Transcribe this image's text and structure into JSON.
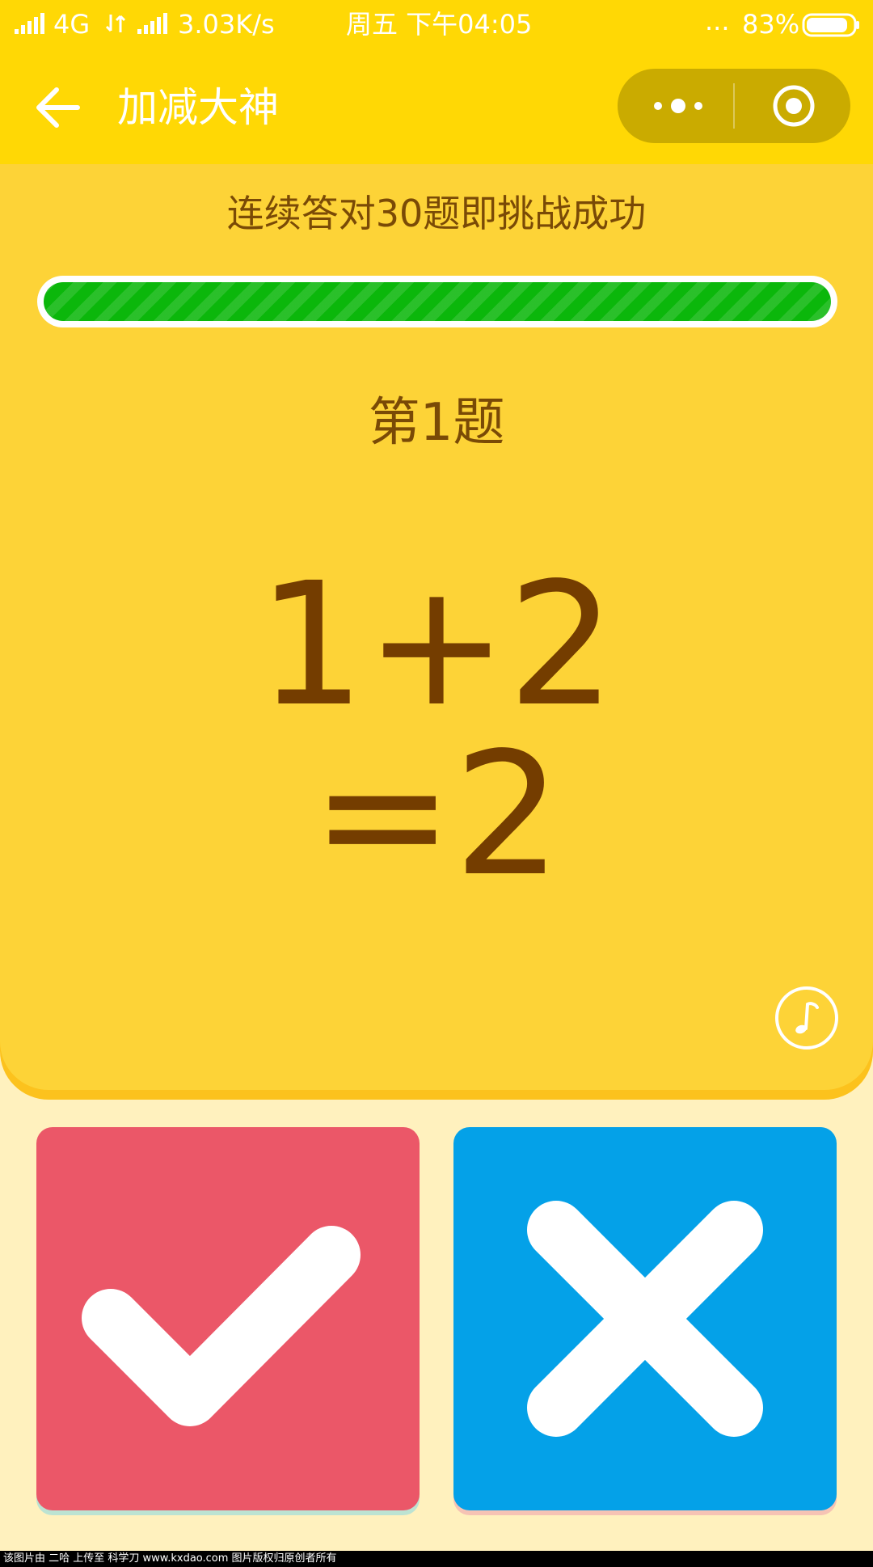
{
  "status_bar": {
    "network": "4G",
    "speed": "3.03K/s",
    "datetime": "周五 下午04:05",
    "more": "...",
    "battery": "83%"
  },
  "nav": {
    "title": "加减大神"
  },
  "game": {
    "challenge_text": "连续答对30题即挑战成功",
    "progress": 1.0,
    "question_label": "第1题",
    "expression": "1+2",
    "answer": "=2"
  },
  "buttons": {
    "correct_icon": "check-icon",
    "wrong_icon": "cross-icon"
  },
  "colors": {
    "header": "#FFD805",
    "card": "#FDD337",
    "text_brown": "#743D00",
    "progress_green": "#0BB70B",
    "correct_button": "#EB5768",
    "wrong_button": "#04A1E8",
    "page_bg": "#FFF1BE"
  },
  "footer": {
    "watermark": "该图片由 二哈 上传至 科学刀 www.kxdao.com 图片版权归原创者所有"
  }
}
